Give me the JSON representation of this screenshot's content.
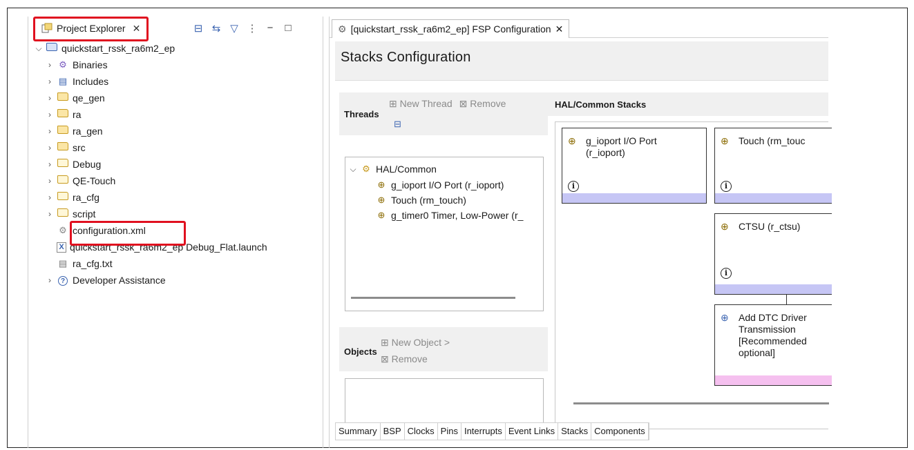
{
  "left_panel": {
    "tab_label": "Project Explorer",
    "tab_close": "✕",
    "toolbar_icons": [
      "collapse-all-icon",
      "link-editor-icon",
      "filter-icon",
      "view-menu-icon",
      "minimize-icon",
      "maximize-icon"
    ],
    "tree": [
      {
        "label": "quickstart_rssk_ra6m2_ep",
        "icon": "project-icon",
        "expanded": true,
        "level": 0
      },
      {
        "label": "Binaries",
        "icon": "binaries-icon",
        "level": 1
      },
      {
        "label": "Includes",
        "icon": "includes-icon",
        "level": 1
      },
      {
        "label": "qe_gen",
        "icon": "source-folder-icon",
        "level": 1
      },
      {
        "label": "ra",
        "icon": "source-folder-icon",
        "level": 1
      },
      {
        "label": "ra_gen",
        "icon": "source-folder-icon",
        "level": 1
      },
      {
        "label": "src",
        "icon": "source-folder-icon",
        "level": 1
      },
      {
        "label": "Debug",
        "icon": "folder-icon",
        "level": 1
      },
      {
        "label": "QE-Touch",
        "icon": "folder-icon",
        "level": 1
      },
      {
        "label": "ra_cfg",
        "icon": "folder-icon",
        "level": 1
      },
      {
        "label": "script",
        "icon": "folder-icon",
        "level": 1
      },
      {
        "label": "configuration.xml",
        "icon": "config-file-icon",
        "level": 1
      },
      {
        "label": "quickstart_rssk_ra6m2_ep Debug_Flat.launch",
        "icon": "launch-file-icon",
        "level": 1
      },
      {
        "label": "ra_cfg.txt",
        "icon": "text-file-icon",
        "level": 1
      },
      {
        "label": "Developer Assistance",
        "icon": "help-icon",
        "level": 1
      }
    ]
  },
  "editor": {
    "tab_label": "[quickstart_rssk_ra6m2_ep] FSP Configuration",
    "tab_close": "✕",
    "title": "Stacks Configuration",
    "threads": {
      "label": "Threads",
      "new_thread": "New Thread",
      "remove": "Remove",
      "root": "HAL/Common",
      "items": [
        "g_ioport I/O Port (r_ioport)",
        "Touch (rm_touch)",
        "g_timer0 Timer, Low-Power (r_"
      ]
    },
    "objects": {
      "label": "Objects",
      "new_object": "New Object >",
      "remove": "Remove"
    },
    "hal": {
      "label": "HAL/Common Stacks",
      "cards": [
        {
          "title_l1": "g_ioport I/O Port",
          "title_l2": "(r_ioport)",
          "bar_color": "#c6c6f5"
        },
        {
          "title_l1": "Touch (rm_touc",
          "title_l2": "",
          "bar_color": "#c6c6f5"
        },
        {
          "title_l1": "CTSU (r_ctsu)",
          "title_l2": "",
          "bar_color": "#c6c6f5"
        },
        {
          "title_l1": "Add DTC Driver",
          "title_l2": "Transmission",
          "title_l3": "[Recommended",
          "title_l4": "optional]",
          "bar_color": "#f5c0ef"
        }
      ]
    },
    "bottom_tabs": [
      "Summary",
      "BSP",
      "Clocks",
      "Pins",
      "Interrupts",
      "Event Links",
      "Stacks",
      "Components"
    ],
    "active_bottom_tab": "Stacks"
  },
  "colors": {
    "highlight": "#e0101f",
    "panel_bg": "#f0f0f0",
    "accent_blue": "#3a63b0"
  }
}
